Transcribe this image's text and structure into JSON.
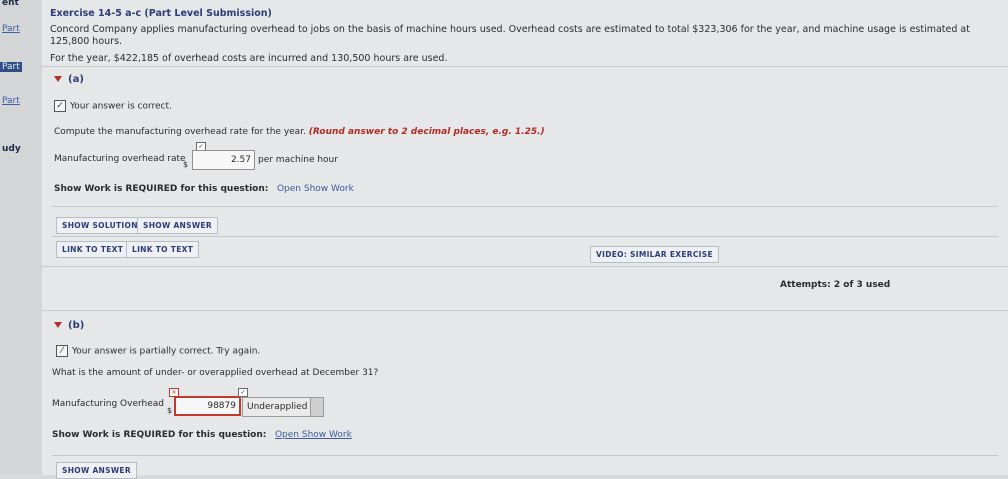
{
  "rail": {
    "items": [
      "ent",
      "Part",
      "Part",
      "Part",
      "udy"
    ]
  },
  "header": {
    "title": "Exercise 14-5 a-c (Part Level Submission)",
    "line1": "Concord Company applies manufacturing overhead to jobs on the basis of machine hours used. Overhead costs are estimated to total $323,306 for the year, and machine usage is estimated at 125,800 hours.",
    "line2": "For the year, $422,185 of overhead costs are incurred and 130,500 hours are used."
  },
  "part_a": {
    "label": "(a)",
    "status": "Your answer is correct.",
    "question_prefix": "Compute the manufacturing overhead rate for the year. ",
    "question_hint": "(Round answer to 2 decimal places, e.g. 1.25.)",
    "field_label": "Manufacturing overhead rate",
    "currency": "$",
    "value": "2.57",
    "unit": "per machine hour",
    "show_work_label": "Show Work is REQUIRED for this question:",
    "show_work_link": "Open Show Work",
    "btn_show_solution": "SHOW SOLUTION",
    "btn_show_answer": "SHOW ANSWER",
    "btn_link1": "LINK TO TEXT",
    "btn_link2": "LINK TO TEXT",
    "btn_video": "VIDEO: SIMILAR EXERCISE",
    "attempts": "Attempts: 2 of 3 used"
  },
  "part_b": {
    "label": "(b)",
    "status": "Your answer is partially correct.  Try again.",
    "question": "What is the amount of under- or overapplied overhead at December 31?",
    "field_label": "Manufacturing Overhead",
    "currency": "$",
    "value": "98879",
    "select_value": "Underapplied",
    "show_work_label": "Show Work is REQUIRED for this question:",
    "show_work_link": "Open Show Work",
    "btn_show_answer": "SHOW ANSWER"
  }
}
